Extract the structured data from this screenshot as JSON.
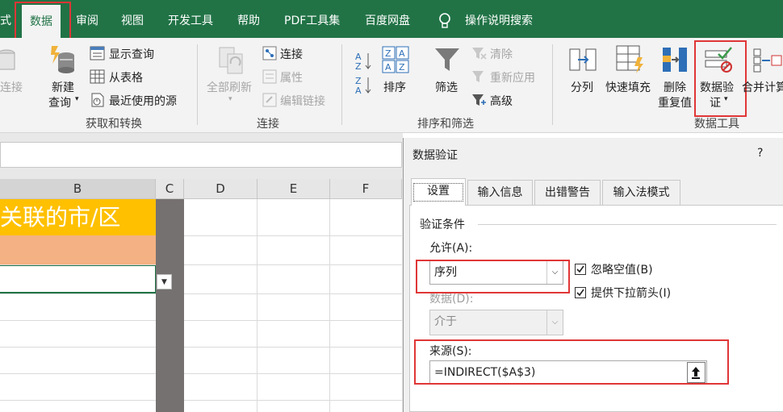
{
  "ribbon_tabs": [
    "式",
    "数据",
    "审阅",
    "视图",
    "开发工具",
    "帮助",
    "PDF工具集",
    "百度网盘",
    "操作说明搜索"
  ],
  "ribbon": {
    "lianjie_partial": "连接",
    "new_query": [
      "新建",
      "查询"
    ],
    "show_query": "显示查询",
    "from_table": "从表格",
    "recent_sources": "最近使用的源",
    "group_get_transform": "获取和转换",
    "refresh_all": "全部刷新",
    "connections": "连接",
    "properties": "属性",
    "edit_links": "编辑链接",
    "group_connections": "连接",
    "sort": "排序",
    "filter": "筛选",
    "clear": "清除",
    "reapply": "重新应用",
    "advanced": "高级",
    "group_sort_filter": "排序和筛选",
    "text_to_columns": "分列",
    "flash_fill": "快速填充",
    "remove_duplicates": [
      "删除",
      "重复值"
    ],
    "data_validation": [
      "数据验",
      "证"
    ],
    "consolidate": "合并计算",
    "group_data_tools": "数据工具"
  },
  "sheet": {
    "columns": [
      "B",
      "C",
      "D",
      "E",
      "F"
    ],
    "b_header_cell": "关联的市/区"
  },
  "dialog": {
    "title": "数据验证",
    "help": "?",
    "tabs": [
      "设置",
      "输入信息",
      "出错警告",
      "输入法模式"
    ],
    "section": "验证条件",
    "allow_label": "允许(A):",
    "allow_value": "序列",
    "ignore_blank": "忽略空值(B)",
    "dropdown": "提供下拉箭头(I)",
    "data_label": "数据(D):",
    "data_value": "介于",
    "source_label": "来源(S):",
    "source_value": "=INDIRECT($A$3)"
  },
  "colors": {
    "excel_green": "#217346",
    "highlight_red": "#e03636",
    "yellow": "#ffc000",
    "salmon": "#f4b183"
  }
}
